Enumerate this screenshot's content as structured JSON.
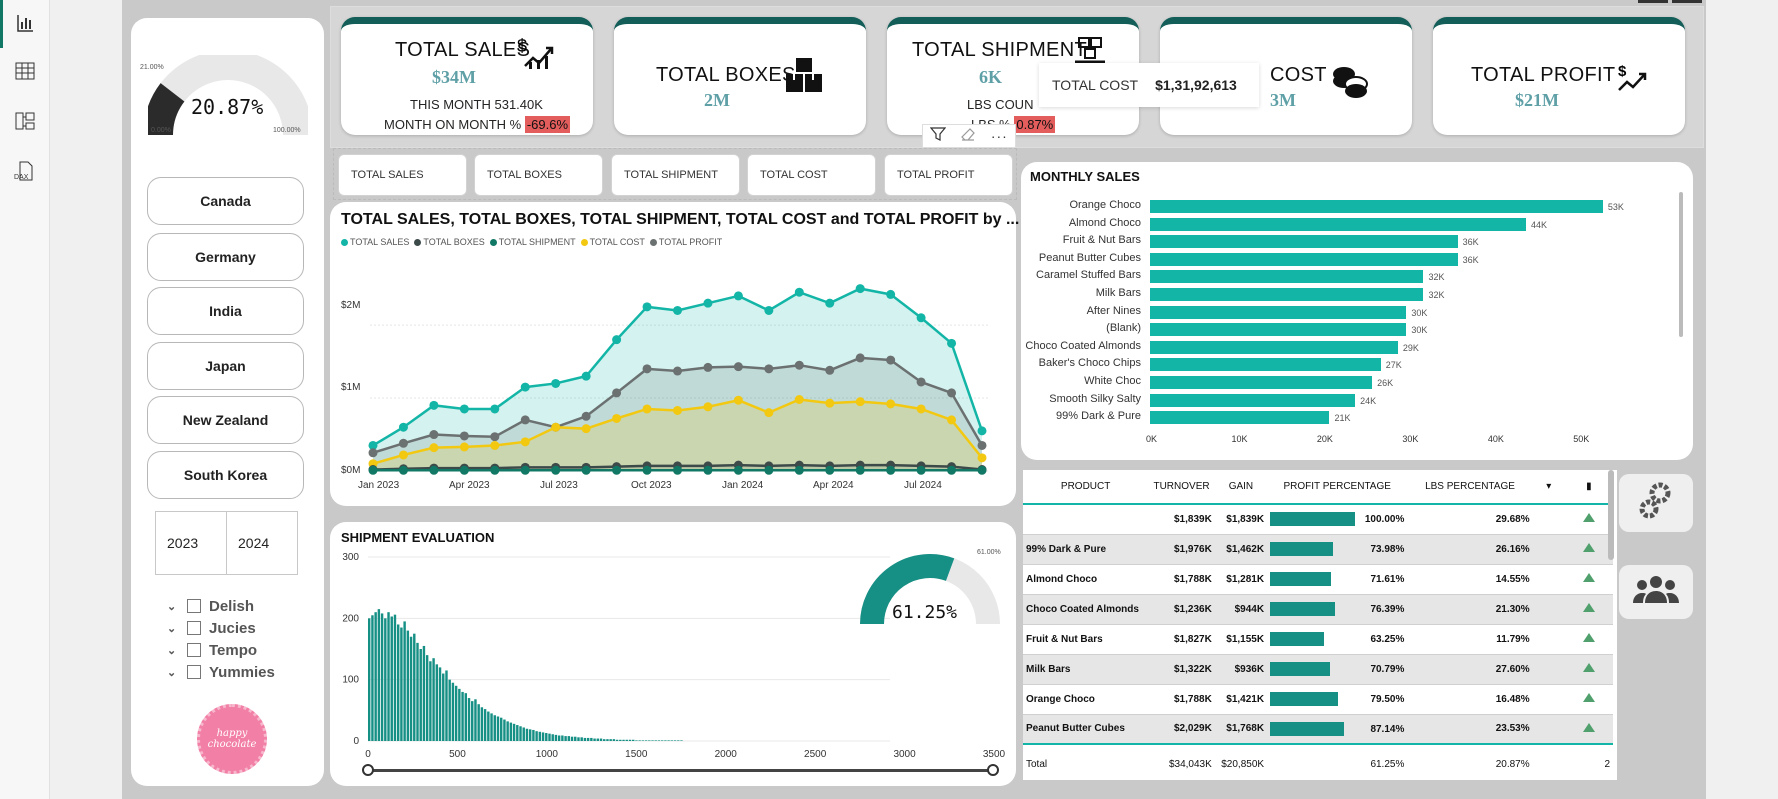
{
  "kpis": [
    {
      "title": "TOTAL SALES",
      "value": "$34M",
      "line1": "THIS MONTH 531.40K",
      "line2_label": "MONTH ON MONTH %",
      "line2_value": "-69.6%"
    },
    {
      "title": "TOTAL BOXES",
      "value": "2M"
    },
    {
      "title": "TOTAL SHIPMENT",
      "value": "6K",
      "line1": "LBS COUN",
      "line2_label": "LBS %",
      "line2_value": "0.87%"
    },
    {
      "title": "COST",
      "value": "3M"
    },
    {
      "title": "TOTAL PROFIT",
      "value": "$21M"
    }
  ],
  "tooltip": {
    "label": "TOTAL COST",
    "value": "$1,31,92,613"
  },
  "gauge": {
    "value_text": "20.87%",
    "min": "0.00%",
    "max": "100.00%",
    "marker": "21.00%",
    "fraction": 0.2087
  },
  "countries": [
    "Canada",
    "Germany",
    "India",
    "Japan",
    "New Zealand",
    "South Korea"
  ],
  "years": [
    "2023",
    "2024"
  ],
  "products_tree": [
    "Delish",
    "Jucies",
    "Tempo",
    "Yummies"
  ],
  "logo_text": "happy chocolate",
  "segments": [
    "TOTAL SALES",
    "TOTAL BOXES",
    "TOTAL SHIPMENT",
    "TOTAL COST",
    "TOTAL PROFIT"
  ],
  "area_chart": {
    "title": "TOTAL SALES, TOTAL BOXES, TOTAL SHIPMENT, TOTAL COST and TOTAL PROFIT by ...",
    "legend": [
      "TOTAL SALES",
      "TOTAL BOXES",
      "TOTAL SHIPMENT",
      "TOTAL COST",
      "TOTAL PROFIT"
    ],
    "colors": [
      "#13b5a7",
      "#3d4a4a",
      "#117865",
      "#f2c811",
      "#6b7070"
    ],
    "y_ticks": [
      "$2M",
      "$1M",
      "$0M"
    ],
    "x_ticks": [
      "Jan 2023",
      "Apr 2023",
      "Jul 2023",
      "Oct 2023",
      "Jan 2024",
      "Apr 2024",
      "Jul 2024"
    ]
  },
  "chart_data": [
    {
      "type": "area",
      "title": "TOTAL SALES, TOTAL BOXES, TOTAL SHIPMENT, TOTAL COST and TOTAL PROFIT by ...",
      "x": [
        "Jan 2023",
        "Feb 2023",
        "Mar 2023",
        "Apr 2023",
        "May 2023",
        "Jun 2023",
        "Jul 2023",
        "Aug 2023",
        "Sep 2023",
        "Oct 2023",
        "Nov 2023",
        "Dec 2023",
        "Jan 2024",
        "Feb 2024",
        "Mar 2024",
        "Apr 2024",
        "May 2024",
        "Jun 2024",
        "Jul 2024",
        "Aug 2024",
        "Sep 2024"
      ],
      "ylim": [
        0,
        2.7
      ],
      "series": [
        {
          "name": "TOTAL SALES",
          "values": [
            0.35,
            0.6,
            0.9,
            0.85,
            0.85,
            1.15,
            1.2,
            1.3,
            1.8,
            2.25,
            2.2,
            2.3,
            2.4,
            2.2,
            2.45,
            2.3,
            2.5,
            2.42,
            2.1,
            1.75,
            0.55
          ]
        },
        {
          "name": "TOTAL BOXES",
          "values": [
            0.02,
            0.03,
            0.04,
            0.04,
            0.04,
            0.05,
            0.05,
            0.05,
            0.06,
            0.07,
            0.07,
            0.07,
            0.08,
            0.07,
            0.08,
            0.07,
            0.08,
            0.08,
            0.07,
            0.06,
            0.02
          ]
        },
        {
          "name": "TOTAL SHIPMENT",
          "values": [
            0.01,
            0.01,
            0.01,
            0.01,
            0.01,
            0.01,
            0.01,
            0.01,
            0.01,
            0.01,
            0.01,
            0.01,
            0.01,
            0.01,
            0.01,
            0.01,
            0.01,
            0.01,
            0.01,
            0.01,
            0.01
          ]
        },
        {
          "name": "TOTAL COST",
          "values": [
            0.1,
            0.22,
            0.32,
            0.33,
            0.35,
            0.4,
            0.6,
            0.58,
            0.72,
            0.85,
            0.83,
            0.88,
            0.97,
            0.8,
            0.98,
            0.93,
            0.95,
            0.92,
            0.85,
            0.7,
            0.18
          ]
        },
        {
          "name": "TOTAL PROFIT",
          "values": [
            0.25,
            0.38,
            0.5,
            0.48,
            0.47,
            0.7,
            0.6,
            0.75,
            1.07,
            1.4,
            1.37,
            1.42,
            1.43,
            1.4,
            1.45,
            1.38,
            1.55,
            1.52,
            1.22,
            1.07,
            0.35
          ]
        }
      ]
    },
    {
      "type": "bar",
      "title": "MONTHLY SALES",
      "categories": [
        "Orange Choco",
        "Almond Choco",
        "Fruit & Nut Bars",
        "Peanut Butter Cubes",
        "Caramel Stuffed Bars",
        "Milk Bars",
        "After Nines",
        "(Blank)",
        "Choco Coated Almonds",
        "Baker's Choco Chips",
        "White Choc",
        "Smooth Silky Salty",
        "99% Dark & Pure"
      ],
      "values": [
        53,
        44,
        36,
        36,
        32,
        32,
        30,
        30,
        29,
        27,
        26,
        24,
        21
      ],
      "labels": [
        "53K",
        "44K",
        "36K",
        "36K",
        "32K",
        "32K",
        "30K",
        "30K",
        "29K",
        "27K",
        "26K",
        "24K",
        "21K"
      ],
      "x_ticks": [
        "0K",
        "10K",
        "20K",
        "30K",
        "40K",
        "50K"
      ],
      "xlim": [
        0,
        58
      ]
    },
    {
      "type": "bar",
      "title": "SHIPMENT EVALUATION",
      "x_ticks": [
        "0",
        "500",
        "1000",
        "1500",
        "2000",
        "2500",
        "3000",
        "3500"
      ],
      "y_ticks": [
        "300",
        "200",
        "100",
        "0"
      ],
      "ylim": [
        0,
        300
      ],
      "xlim": [
        0,
        3500
      ],
      "values": [
        200,
        205,
        210,
        215,
        208,
        200,
        210,
        203,
        206,
        190,
        185,
        195,
        180,
        170,
        175,
        160,
        150,
        155,
        140,
        130,
        135,
        125,
        120,
        110,
        115,
        100,
        95,
        90,
        85,
        80,
        78,
        70,
        65,
        68,
        60,
        55,
        52,
        48,
        45,
        42,
        40,
        38,
        35,
        32,
        30,
        28,
        26,
        24,
        22,
        20,
        19,
        18,
        16,
        15,
        14,
        13,
        12,
        11,
        10,
        9,
        9,
        8,
        8,
        7,
        7,
        6,
        6,
        5,
        5,
        5,
        4,
        4,
        4,
        3,
        3,
        3,
        3,
        2,
        2,
        2,
        2,
        2,
        2,
        1,
        1,
        1,
        1,
        1,
        1,
        1,
        1,
        1,
        1,
        1,
        1,
        1,
        1,
        1
      ]
    }
  ],
  "monthly_sales": {
    "title": "MONTHLY SALES"
  },
  "shipment": {
    "title": "SHIPMENT EVALUATION",
    "donut_text": "61.25%",
    "donut_label": "61.00%",
    "donut_fraction": 0.6125
  },
  "table": {
    "headers": [
      "PRODUCT",
      "TURNOVER",
      "GAIN",
      "PROFIT PERCENTAGE",
      "LBS PERCENTAGE"
    ],
    "rows": [
      {
        "product": "",
        "turnover": "$1,839K",
        "gain": "$1,839K",
        "pct": "100.00%",
        "pct_val": 100,
        "lbs": "29.68%"
      },
      {
        "product": "99% Dark & Pure",
        "turnover": "$1,976K",
        "gain": "$1,462K",
        "pct": "73.98%",
        "pct_val": 73.98,
        "lbs": "26.16%"
      },
      {
        "product": "Almond Choco",
        "turnover": "$1,788K",
        "gain": "$1,281K",
        "pct": "71.61%",
        "pct_val": 71.61,
        "lbs": "14.55%"
      },
      {
        "product": "Choco Coated Almonds",
        "turnover": "$1,236K",
        "gain": "$944K",
        "pct": "76.39%",
        "pct_val": 76.39,
        "lbs": "21.30%"
      },
      {
        "product": "Fruit & Nut Bars",
        "turnover": "$1,827K",
        "gain": "$1,155K",
        "pct": "63.25%",
        "pct_val": 63.25,
        "lbs": "11.79%"
      },
      {
        "product": "Milk Bars",
        "turnover": "$1,322K",
        "gain": "$936K",
        "pct": "70.79%",
        "pct_val": 70.79,
        "lbs": "27.60%"
      },
      {
        "product": "Orange Choco",
        "turnover": "$1,788K",
        "gain": "$1,421K",
        "pct": "79.50%",
        "pct_val": 79.5,
        "lbs": "16.48%"
      },
      {
        "product": "Peanut Butter Cubes",
        "turnover": "$2,029K",
        "gain": "$1,768K",
        "pct": "87.14%",
        "pct_val": 87.14,
        "lbs": "23.53%"
      }
    ],
    "total": {
      "product": "Total",
      "turnover": "$34,043K",
      "gain": "$20,850K",
      "pct": "61.25%",
      "lbs": "20.87%",
      "extra": "2"
    }
  },
  "colors": {
    "teal": "#13b5a7",
    "dark_teal": "#135e58",
    "yellow": "#f2c811",
    "negative": "#e35d5d"
  },
  "icons": [
    "bar-chart-icon",
    "table-icon",
    "model-icon",
    "dax-icon",
    "filter-icon",
    "eraser-icon",
    "more-icon",
    "settings-icon",
    "people-icon"
  ]
}
